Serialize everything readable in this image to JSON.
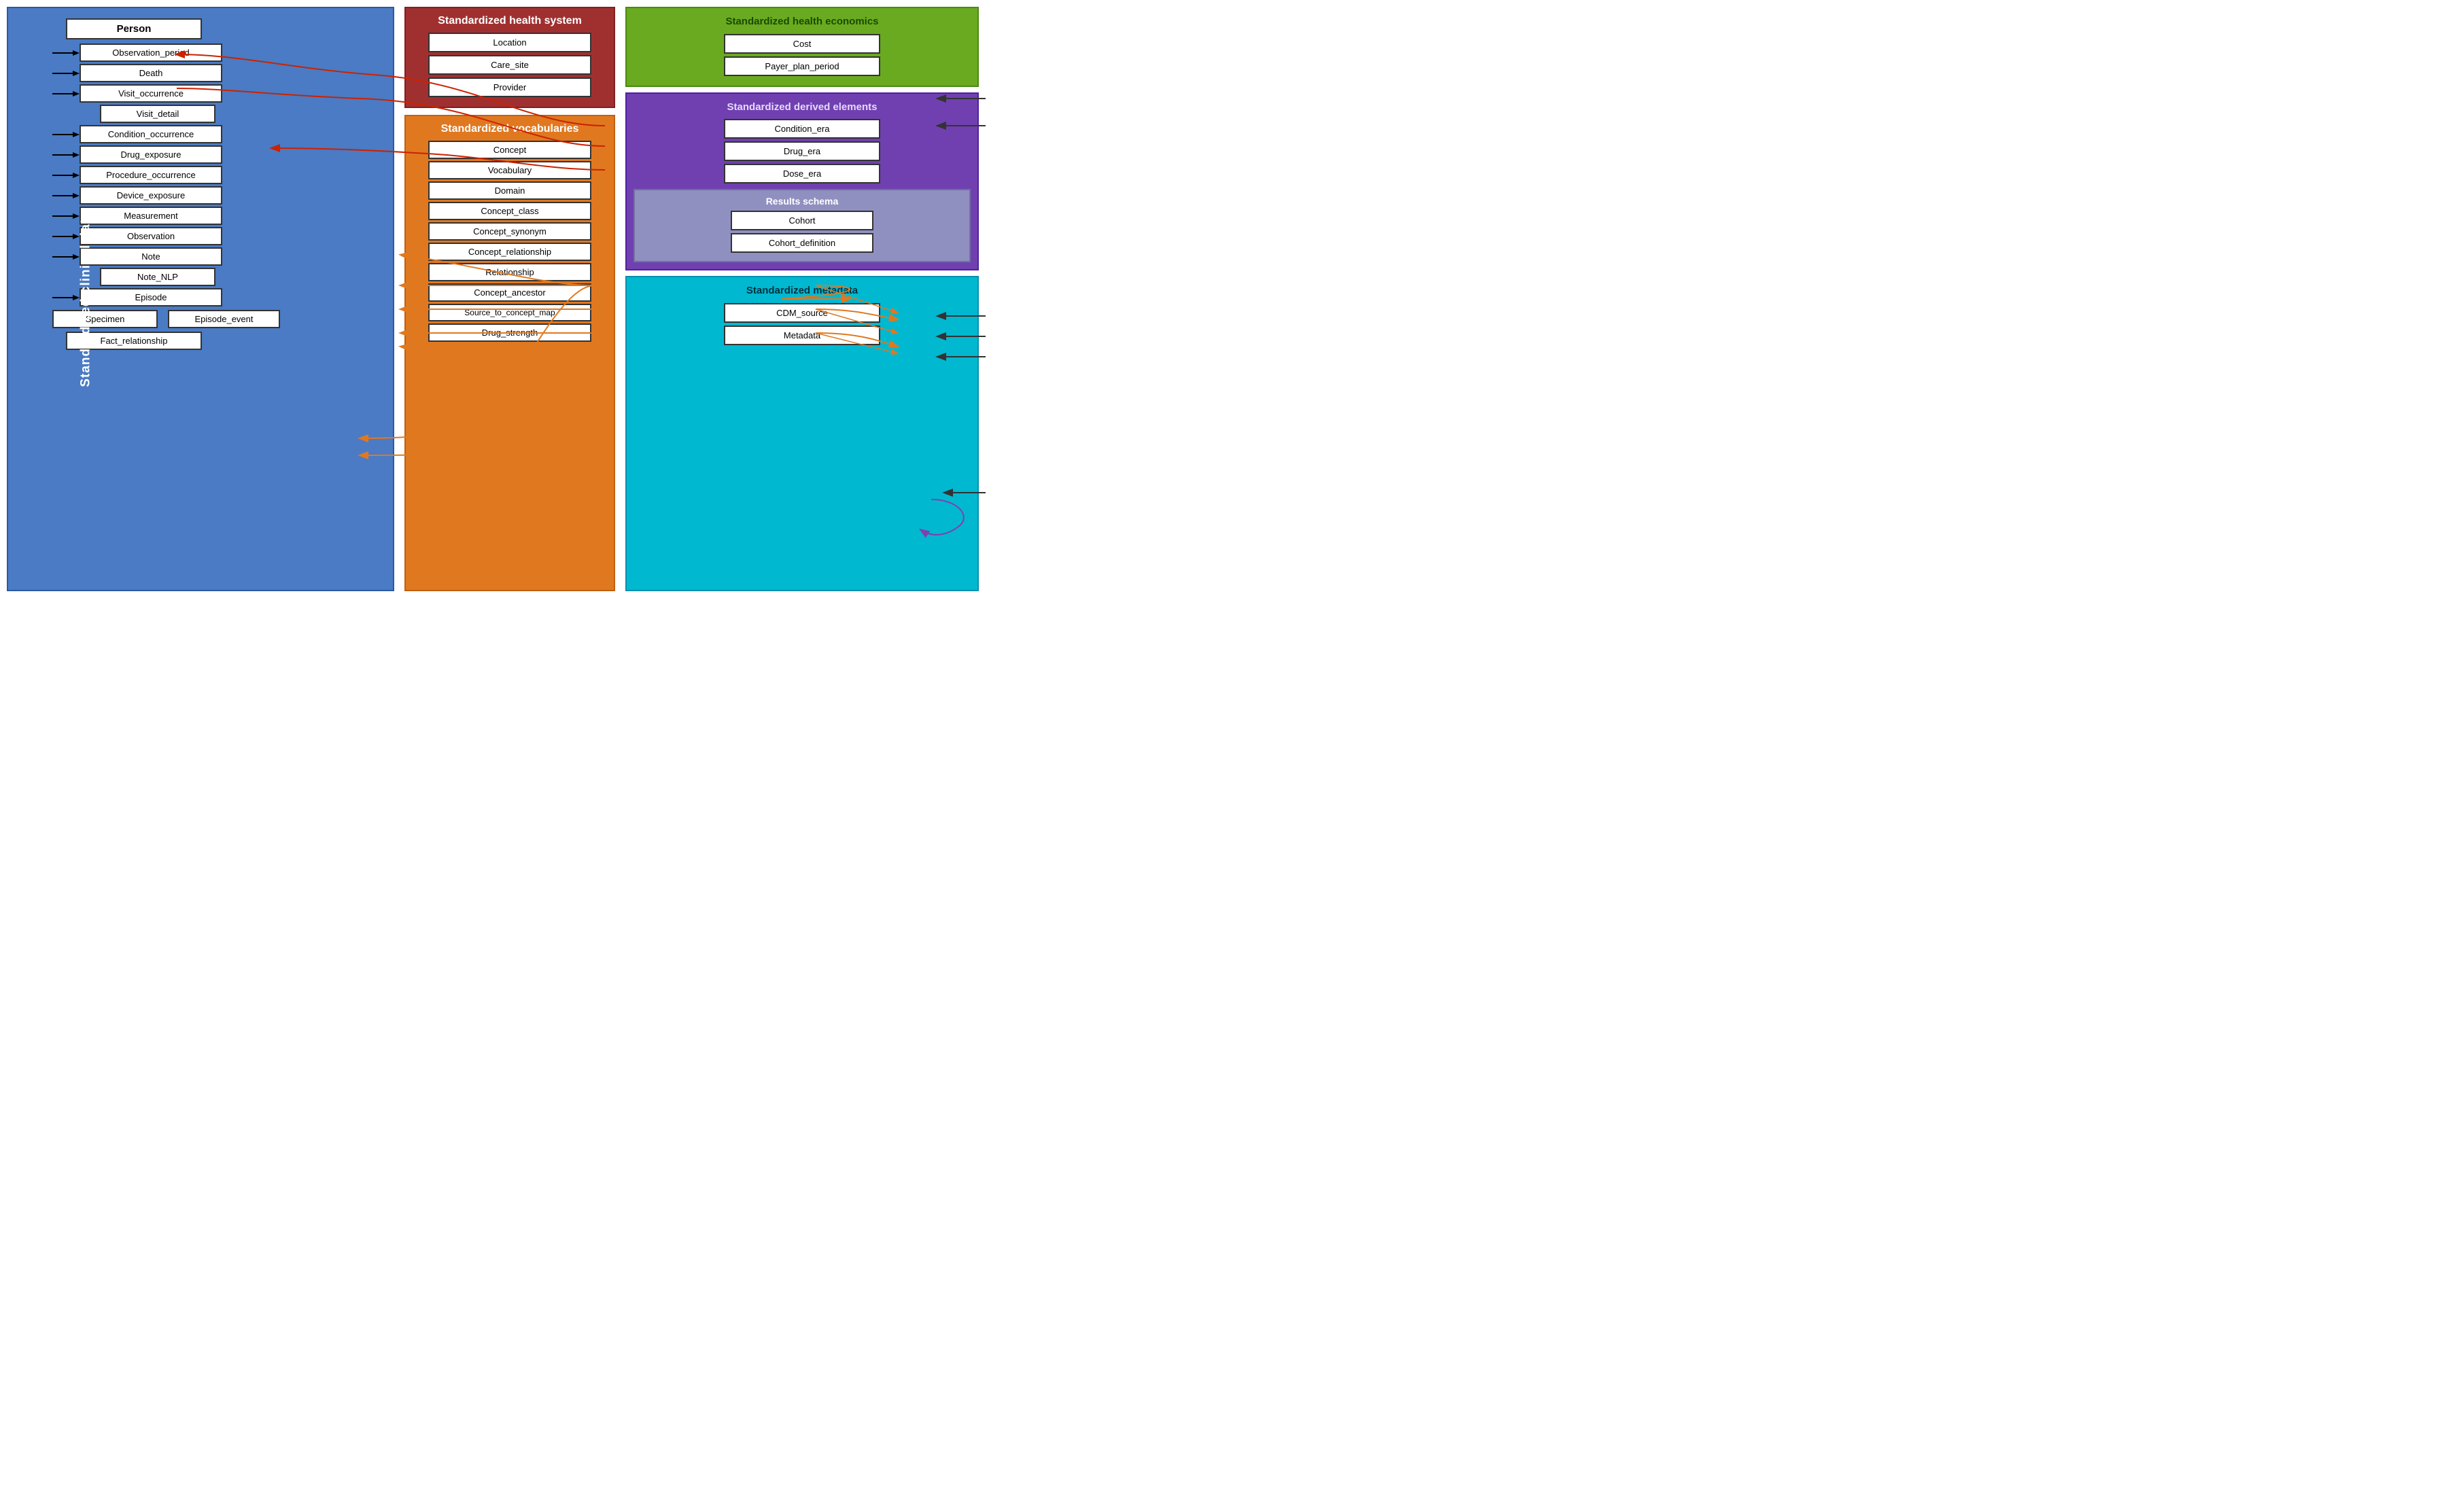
{
  "leftPanel": {
    "sectionLabel": "Standardized clinical data",
    "items": [
      {
        "label": "Person",
        "type": "person"
      },
      {
        "label": "Observation_period",
        "type": "main"
      },
      {
        "label": "Death",
        "type": "main"
      },
      {
        "label": "Visit_occurrence",
        "type": "main"
      },
      {
        "label": "Visit_detail",
        "type": "sub"
      },
      {
        "label": "Condition_occurrence",
        "type": "main"
      },
      {
        "label": "Drug_exposure",
        "type": "main"
      },
      {
        "label": "Procedure_occurrence",
        "type": "main"
      },
      {
        "label": "Device_exposure",
        "type": "main"
      },
      {
        "label": "Measurement",
        "type": "main"
      },
      {
        "label": "Observation",
        "type": "main"
      },
      {
        "label": "Note",
        "type": "main"
      },
      {
        "label": "Note_NLP",
        "type": "sub"
      },
      {
        "label": "Episode",
        "type": "main"
      },
      {
        "label": "Specimen",
        "type": "bottom"
      },
      {
        "label": "Episode_event",
        "type": "bottom"
      },
      {
        "label": "Fact_relationship",
        "type": "bottom"
      }
    ]
  },
  "middleTopPanel": {
    "title": "Standardized health system",
    "items": [
      {
        "label": "Location"
      },
      {
        "label": "Care_site"
      },
      {
        "label": "Provider"
      }
    ]
  },
  "middlePanel": {
    "title": "Standardized vocabularies",
    "items": [
      {
        "label": "Concept"
      },
      {
        "label": "Vocabulary"
      },
      {
        "label": "Domain"
      },
      {
        "label": "Concept_class"
      },
      {
        "label": "Concept_synonym"
      },
      {
        "label": "Concept_relationship"
      },
      {
        "label": "Relationship"
      },
      {
        "label": "Concept_ancestor"
      },
      {
        "label": "Source_to_concept_map"
      },
      {
        "label": "Drug_strength"
      }
    ]
  },
  "rightPanels": {
    "healthEconomics": {
      "title": "Standardized\nhealth economics",
      "items": [
        {
          "label": "Cost"
        },
        {
          "label": "Payer_plan_period"
        }
      ]
    },
    "derivedElements": {
      "title": "Standardized\nderived elements",
      "items": [
        {
          "label": "Condition_era"
        },
        {
          "label": "Drug_era"
        },
        {
          "label": "Dose_era"
        }
      ]
    },
    "resultsSchema": {
      "title": "Results schema",
      "items": [
        {
          "label": "Cohort"
        },
        {
          "label": "Cohort_definition"
        }
      ]
    },
    "metadata": {
      "title": "Standardized\nmetadata",
      "items": [
        {
          "label": "CDM_source"
        },
        {
          "label": "Metadata"
        }
      ]
    }
  }
}
